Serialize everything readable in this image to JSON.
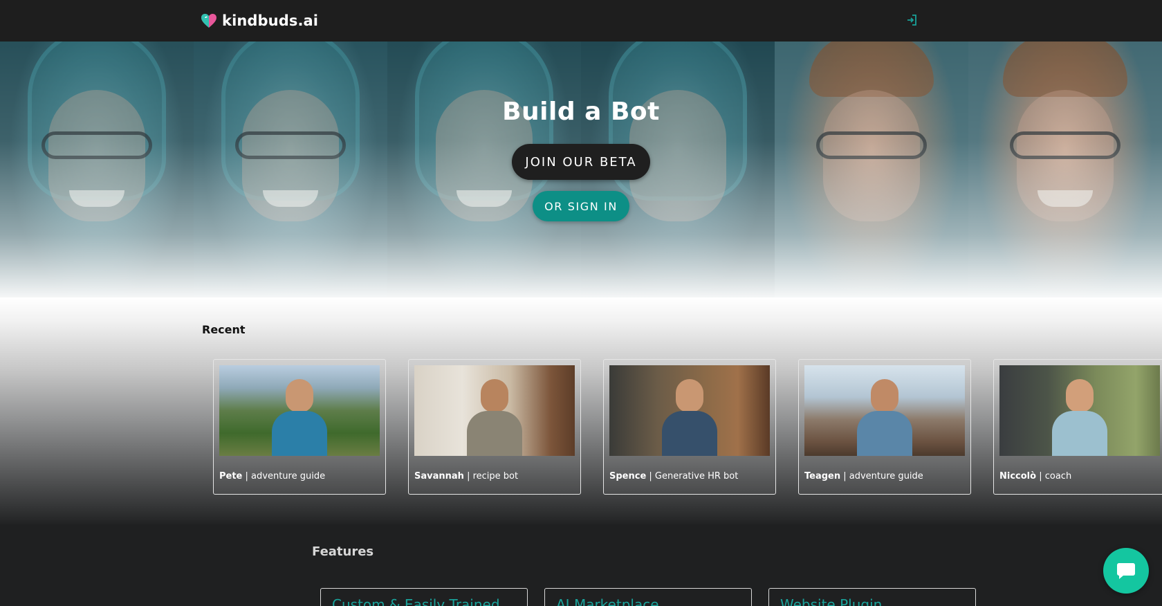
{
  "nav": {
    "brand_name": "kindbuds.ai",
    "brand_icon": "heart-logo-icon",
    "login_icon": "sign-in-icon"
  },
  "hero": {
    "title": "Build a Bot",
    "join_label": "JOIN OUR BETA",
    "signin_label": "OR SIGN IN"
  },
  "recent": {
    "title": "Recent",
    "bots": [
      {
        "name": "Pete",
        "role": "| adventure guide"
      },
      {
        "name": "Savannah",
        "role": "| recipe bot"
      },
      {
        "name": "Spence",
        "role": "| Generative HR bot"
      },
      {
        "name": "Teagen",
        "role": "| adventure guide"
      },
      {
        "name": "Niccolò",
        "role": "| coach"
      }
    ]
  },
  "features": {
    "title": "Features",
    "items": [
      {
        "label": "Custom & Easily Trained"
      },
      {
        "label": "AI Marketplace"
      },
      {
        "label": "Website Plugin"
      }
    ]
  },
  "chat": {
    "icon": "chat-bubble-icon"
  },
  "colors": {
    "accent_teal": "#0d8f86",
    "chat_fab": "#14c6a0",
    "nav_bg": "#1e1e1e",
    "feature_text": "#19a29a"
  }
}
